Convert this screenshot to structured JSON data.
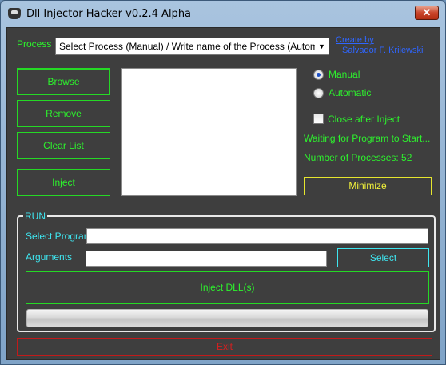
{
  "window": {
    "title": "Dll Injector Hacker  v0.2.4 Alpha",
    "close_glyph": "✕"
  },
  "process": {
    "label": "Process",
    "select_value": "Select Process (Manual)  /  Write name of the Process (Automatic)",
    "credit_line1": "Create by",
    "credit_line2": "Salvador F. Krilewski"
  },
  "buttons": {
    "browse": "Browse",
    "remove": "Remove",
    "clear_list": "Clear List",
    "inject": "Inject",
    "minimize": "Minimize",
    "exit": "Exit"
  },
  "dll_list": {
    "items": []
  },
  "mode": {
    "manual_label": "Manual",
    "automatic_label": "Automatic",
    "selected": "Manual"
  },
  "options": {
    "close_after_inject_label": "Close after Inject",
    "close_after_inject_checked": false
  },
  "status": {
    "message": "Waiting for Program to Start...",
    "process_count_text": "Number of Processes: 52"
  },
  "run": {
    "legend": "RUN",
    "select_program_label": "Select Program",
    "select_program_value": "",
    "arguments_label": "Arguments",
    "arguments_value": "",
    "select_button": "Select",
    "inject_dlls_button": "Inject DLL(s)",
    "progress_percent": 0
  },
  "colors": {
    "background": "#3e3e3e",
    "green": "#2df22d",
    "cyan": "#3ee6f0",
    "yellow": "#f2f23a",
    "red": "#d42020",
    "link": "#2f66ff"
  }
}
